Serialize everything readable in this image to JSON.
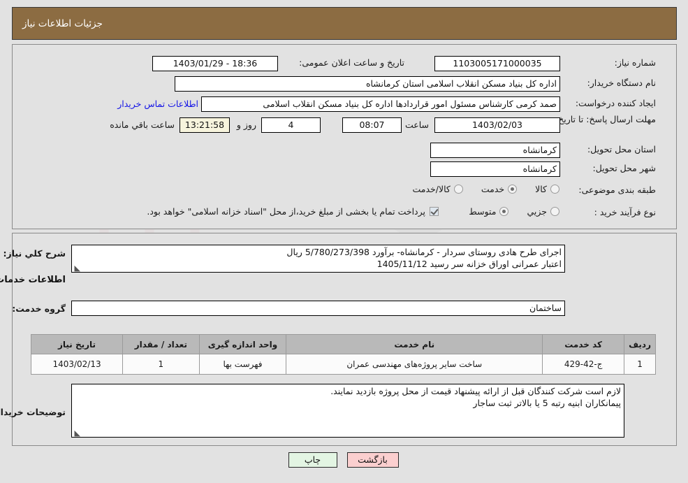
{
  "header": {
    "title": "جزئیات اطلاعات نیاز"
  },
  "top_section": {
    "need_number": {
      "label": "شماره نیاز:",
      "value": "1103005171000035"
    },
    "public_announce": {
      "label": "تاریخ و ساعت اعلان عمومی:",
      "value": "18:36 - 1403/01/29"
    },
    "buyer_org": {
      "label": "نام دستگاه خریدار:",
      "value": "اداره کل بنیاد مسکن انقلاب اسلامی استان کرمانشاه"
    },
    "requester": {
      "label": "ایجاد کننده درخواست:",
      "value": "صمد کرمی کارشناس مسئول امور قراردادها اداره کل بنیاد مسکن انقلاب اسلامی",
      "link_label": "اطلاعات تماس خریدار"
    },
    "deadline": {
      "label": "مهلت ارسال پاسخ: تا تاریخ:",
      "date": "1403/02/03",
      "hour_label": "ساعت",
      "hour": "08:07",
      "days": "4",
      "days_label": "روز و",
      "countdown": "13:21:58",
      "remaining_label": "ساعت باقي مانده"
    },
    "province": {
      "label": "استان محل تحویل:",
      "value": "کرمانشاه"
    },
    "city": {
      "label": "شهر محل تحویل:",
      "value": "کرمانشاه"
    },
    "category": {
      "label": "طبقه بندی موضوعی:",
      "options": [
        "کالا",
        "خدمت",
        "کالا/خدمت"
      ],
      "selected": "خدمت"
    },
    "process_type": {
      "label": "نوع فرآیند خرید :",
      "options": [
        "جزیي",
        "متوسط"
      ],
      "selected": "متوسط",
      "note": "پرداخت تمام یا بخشی از مبلغ خرید،از محل \"اسناد خزانه اسلامی\" خواهد بود.",
      "note_checked": true
    }
  },
  "bottom_section": {
    "general_desc": {
      "label": "شرح کلي نیاز:",
      "line1": "اجرای طرح هادی روستای سردار - کرمانشاه- برآورد 5/780/273/398 ریال",
      "line2": "اعتبار عمرانی اوراق خزانه سر رسید 1405/11/12"
    },
    "services_heading": "اطلاعات خدمات مورد نیاز",
    "service_group": {
      "label": "گروه خدمت:",
      "value": "ساختمان"
    },
    "table": {
      "columns": [
        "ردیف",
        "کد خدمت",
        "نام خدمت",
        "واحد اندازه گیری",
        "تعداد / مقدار",
        "تاریخ نیاز"
      ],
      "rows": [
        {
          "radif": "1",
          "code": "ج-42-429",
          "name": "ساخت سایر پروژه‌های مهندسی عمران",
          "unit": "فهرست بها",
          "qty": "1",
          "date": "1403/02/13"
        }
      ]
    },
    "buyer_notes": {
      "label": "توضیحات خریدار:",
      "line1": "لازم است شرکت کنندگان قبل از ارائه پیشنهاد قیمت از محل پروژه بازدید نمایند.",
      "line2": "پیمانکاران ابنیه رتبه 5 یا بالاتر ثبت ساجار"
    }
  },
  "buttons": {
    "print": "چاپ",
    "back": "بازگشت"
  },
  "colors": {
    "header_bar": "#8c6c42",
    "page_bg": "#e2e2e2",
    "link": "#1414e6",
    "table_header": "#b9b9b9",
    "btn_print": "#e3f5e3",
    "btn_back": "#fbcfcf",
    "countdown_bg": "#f7f4dd"
  },
  "watermark": {
    "text": "AriaTender.net"
  }
}
